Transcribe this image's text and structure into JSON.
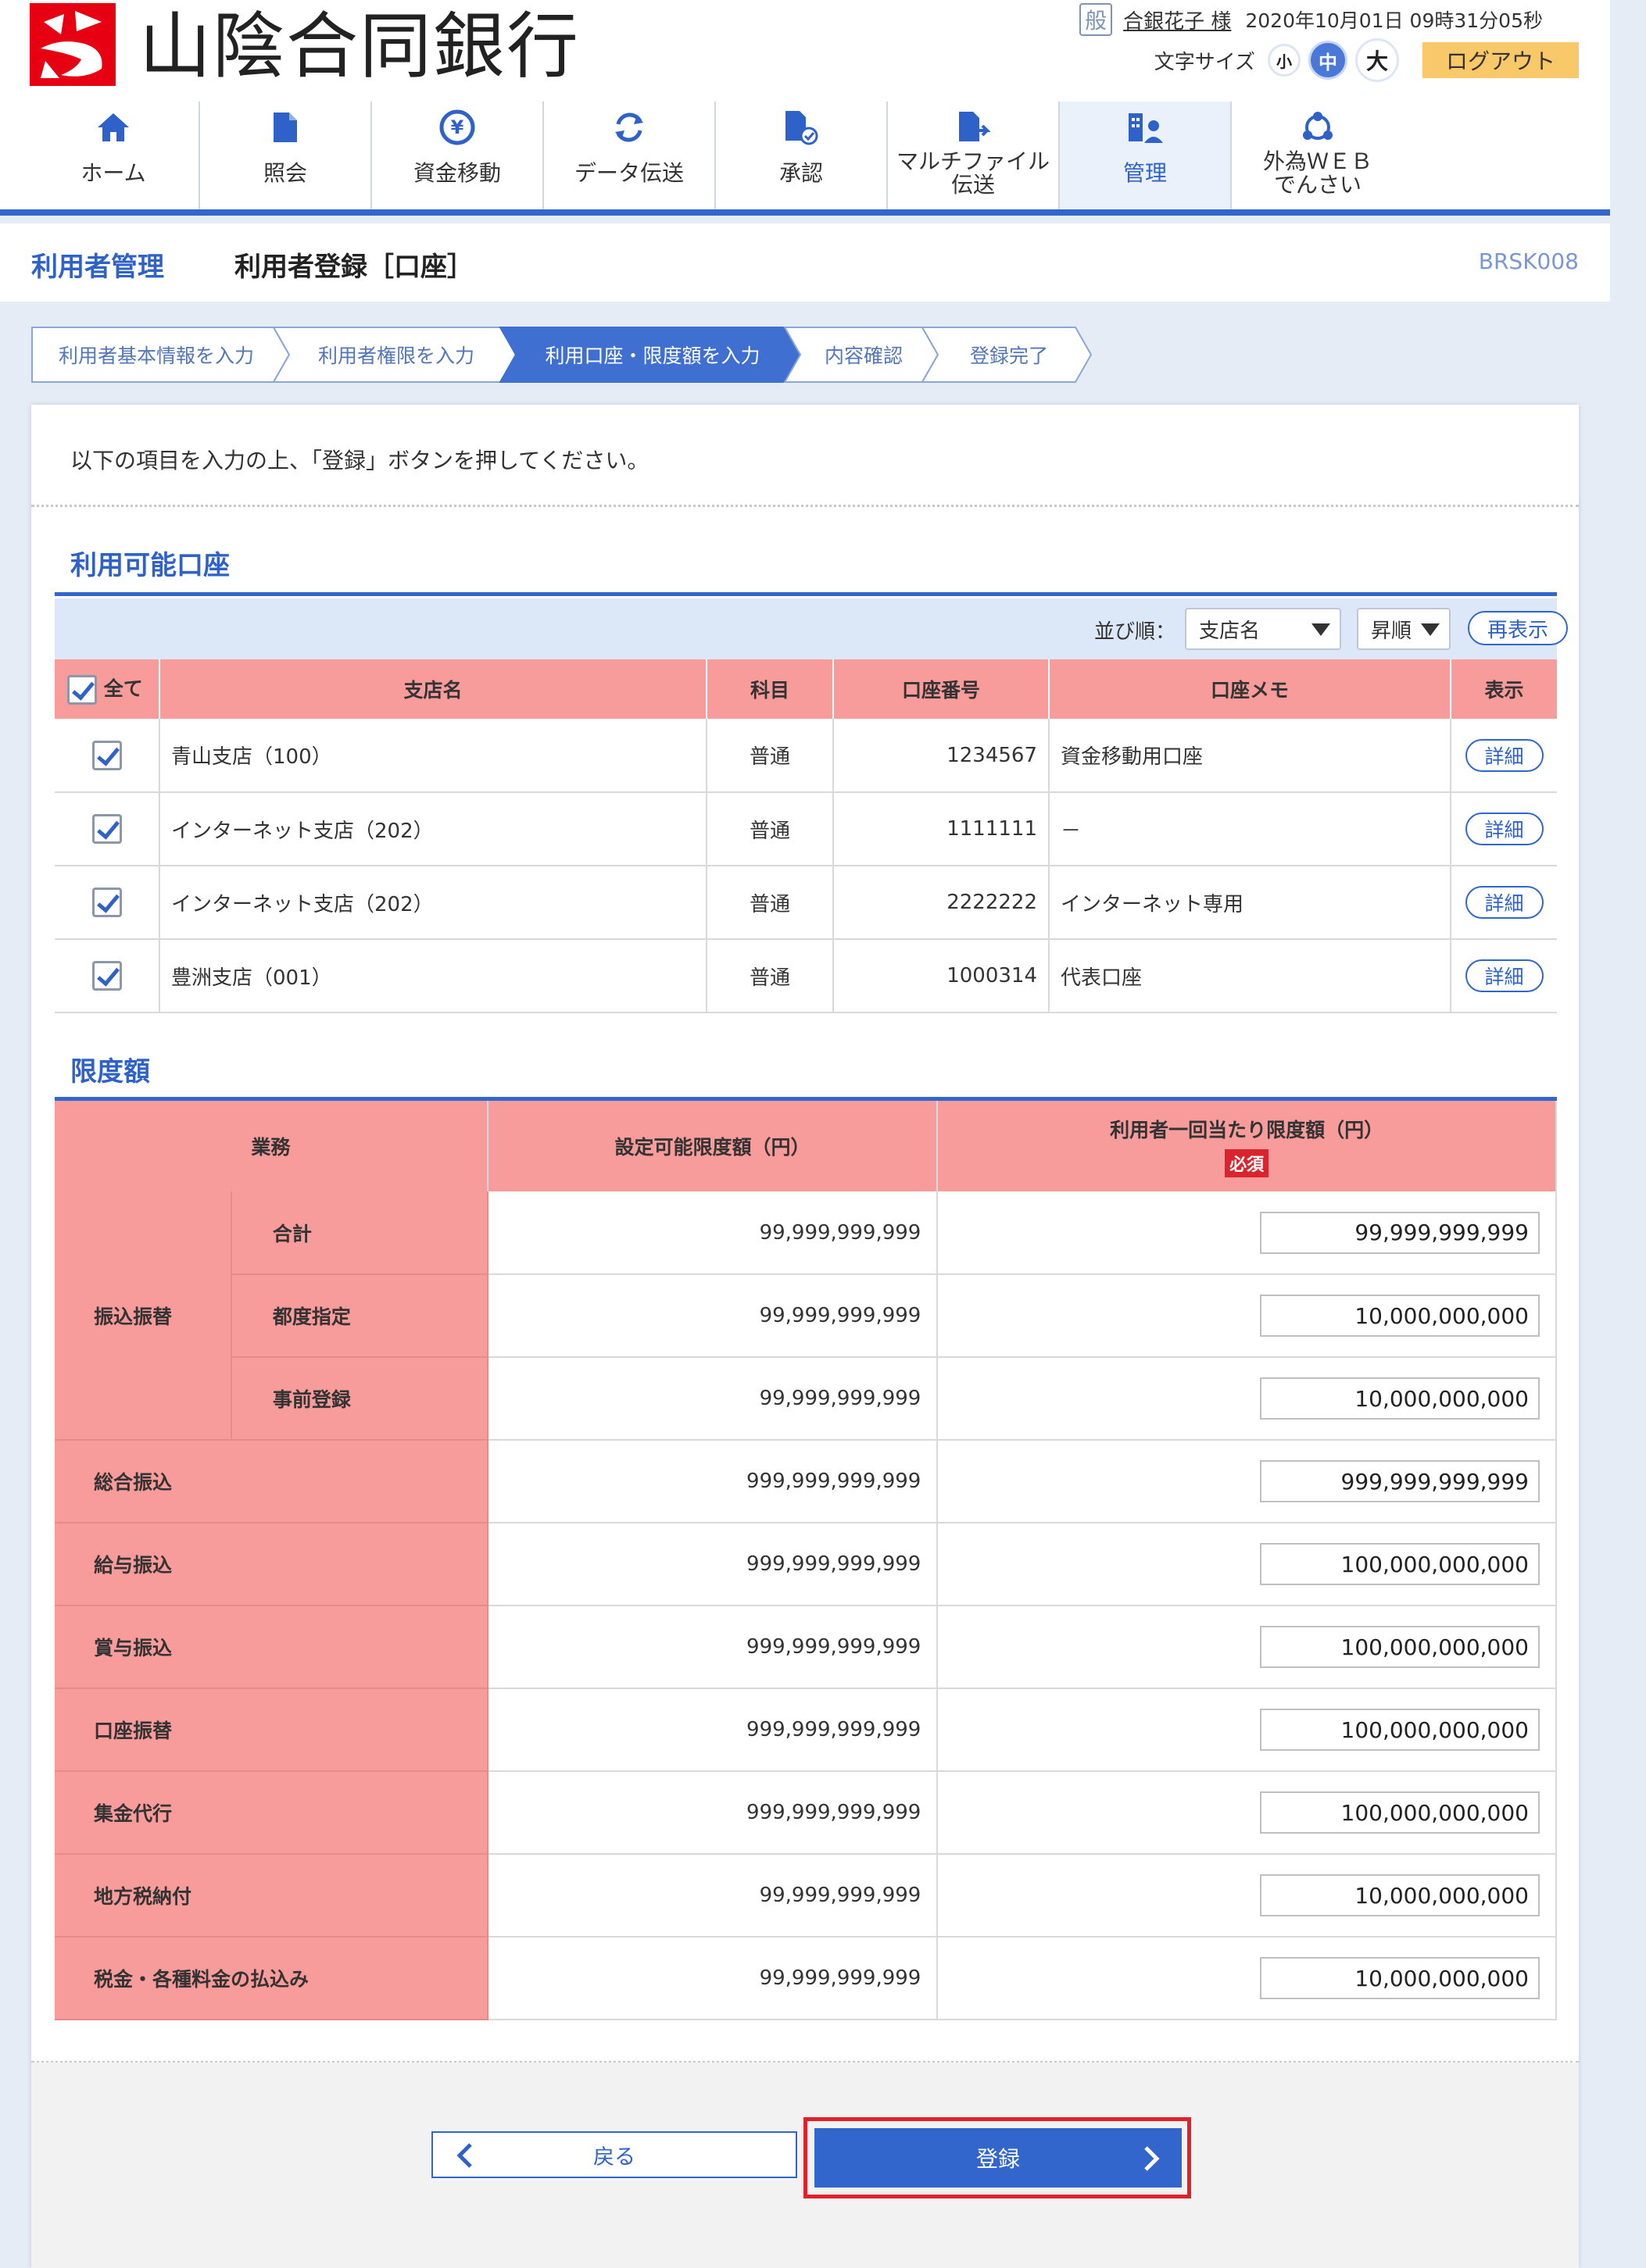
{
  "header": {
    "bank_name": "山陰合同銀行",
    "user_badge": "般",
    "user_name": "合銀花子 様",
    "datetime": "2020年10月01日 09時31分05秒",
    "font_size_label": "文字サイズ",
    "font_small": "小",
    "font_medium": "中",
    "font_large": "大",
    "logout": "ログアウト",
    "brand_color": "#e60012"
  },
  "nav": {
    "items": [
      {
        "label": "ホーム",
        "icon": "home-icon"
      },
      {
        "label": "照会",
        "icon": "document-icon"
      },
      {
        "label": "資金移動",
        "icon": "yen-transfer-icon"
      },
      {
        "label": "データ伝送",
        "icon": "refresh-icon"
      },
      {
        "label": "承認",
        "icon": "approve-document-icon"
      },
      {
        "label_line1": "マルチファイル",
        "label_line2": "伝送",
        "icon": "file-send-icon"
      },
      {
        "label": "管理",
        "icon": "management-icon",
        "active": true
      },
      {
        "label_line1": "外為ＷＥＢ",
        "label_line2": "でんさい",
        "icon": "network-icon"
      }
    ]
  },
  "title": {
    "section": "利用者管理",
    "page": "利用者登録［口座］",
    "code": "BRSK008"
  },
  "steps": [
    "利用者基本情報を入力",
    "利用者権限を入力",
    "利用口座・限度額を入力",
    "内容確認",
    "登録完了"
  ],
  "current_step": 3,
  "instruction": "以下の項目を入力の上、「登録」ボタンを押してください。",
  "accounts": {
    "title": "利用可能口座",
    "sort_label": "並び順：",
    "sort_key": "支店名",
    "sort_order": "昇順",
    "redisplay": "再表示",
    "columns": {
      "all": "全て",
      "branch": "支店名",
      "subject": "科目",
      "number": "口座番号",
      "memo": "口座メモ",
      "display": "表示"
    },
    "rows": [
      {
        "branch": "青山支店（100）",
        "subject": "普通",
        "number": "1234567",
        "memo": "資金移動用口座",
        "detail": "詳細"
      },
      {
        "branch": "インターネット支店（202）",
        "subject": "普通",
        "number": "1111111",
        "memo": "－",
        "detail": "詳細"
      },
      {
        "branch": "インターネット支店（202）",
        "subject": "普通",
        "number": "2222222",
        "memo": "インターネット専用",
        "detail": "詳細"
      },
      {
        "branch": "豊洲支店（001）",
        "subject": "普通",
        "number": "1000314",
        "memo": "代表口座",
        "detail": "詳細"
      }
    ]
  },
  "limits": {
    "title": "限度額",
    "col_business": "業務",
    "col_max": "設定可能限度額（円）",
    "col_user": "利用者一回当たり限度額（円）",
    "required": "必須",
    "group_transfer": "振込振替",
    "rows": [
      {
        "label": "合計",
        "max": "99,999,999,999",
        "value": "99,999,999,999"
      },
      {
        "label": "都度指定",
        "max": "99,999,999,999",
        "value": "10,000,000,000"
      },
      {
        "label": "事前登録",
        "max": "99,999,999,999",
        "value": "10,000,000,000"
      },
      {
        "label": "総合振込",
        "max": "999,999,999,999",
        "value": "999,999,999,999"
      },
      {
        "label": "給与振込",
        "max": "999,999,999,999",
        "value": "100,000,000,000"
      },
      {
        "label": "賞与振込",
        "max": "999,999,999,999",
        "value": "100,000,000,000"
      },
      {
        "label": "口座振替",
        "max": "999,999,999,999",
        "value": "100,000,000,000"
      },
      {
        "label": "集金代行",
        "max": "999,999,999,999",
        "value": "100,000,000,000"
      },
      {
        "label": "地方税納付",
        "max": "99,999,999,999",
        "value": "10,000,000,000"
      },
      {
        "label": "税金・各種料金の払込み",
        "max": "99,999,999,999",
        "value": "10,000,000,000"
      }
    ]
  },
  "footer": {
    "back": "戻る",
    "register": "登録"
  }
}
